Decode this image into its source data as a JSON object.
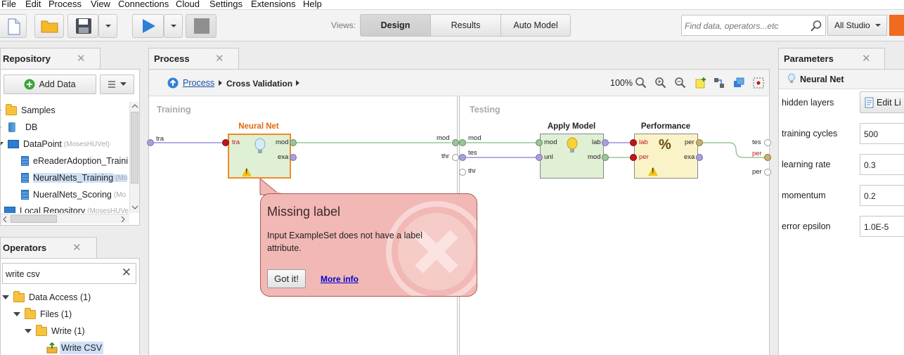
{
  "menu": [
    "File",
    "Edit",
    "Process",
    "View",
    "Connections",
    "Cloud",
    "Settings",
    "Extensions",
    "Help"
  ],
  "toolbar": {
    "views_label": "Views:",
    "views": [
      "Design",
      "Results",
      "Auto Model"
    ],
    "active_view": "Design",
    "search_placeholder": "Find data, operators...etc",
    "studio_label": "All Studio"
  },
  "repository": {
    "tab_title": "Repository",
    "add_data_label": "Add Data",
    "items": [
      {
        "label": "Samples",
        "sub": ""
      },
      {
        "label": "DB",
        "sub": ""
      },
      {
        "label": "DataPoint",
        "sub": "(MosesHUVet)"
      },
      {
        "label": "eReaderAdoption_Traini",
        "sub": ""
      },
      {
        "label": "NeuralNets_Training",
        "sub": "(Mo"
      },
      {
        "label": "NueralNets_Scoring",
        "sub": "(Mo"
      },
      {
        "label": "Local Repository",
        "sub": "(MosesHUVe"
      }
    ]
  },
  "operators": {
    "tab_title": "Operators",
    "search_value": "write csv",
    "tree": [
      {
        "label": "Data Access (1)"
      },
      {
        "label": "Files (1)"
      },
      {
        "label": "Write (1)"
      },
      {
        "label": "Write CSV"
      }
    ]
  },
  "process": {
    "tab_title": "Process",
    "breadcrumb": [
      "Process",
      "Cross Validation"
    ],
    "zoom": "100%",
    "training_label": "Training",
    "testing_label": "Testing",
    "left_port": "tra",
    "neural_net": {
      "title": "Neural Net",
      "in_port": "tra",
      "out_ports": [
        "mod",
        "exa"
      ]
    },
    "divider_ports_left": [
      "mod",
      "thr"
    ],
    "divider_ports_right": [
      "mod",
      "tes",
      "thr"
    ],
    "apply_model": {
      "title": "Apply Model",
      "in_ports": [
        "mod",
        "unl"
      ],
      "out_ports": [
        "lab",
        "mod"
      ]
    },
    "performance": {
      "title": "Performance",
      "in_ports": [
        "lab",
        "per"
      ],
      "out_ports": [
        "per",
        "exa"
      ]
    },
    "right_ports": [
      "tes",
      "per",
      "per"
    ]
  },
  "tooltip": {
    "title": "Missing label",
    "body": "Input ExampleSet does not have a label attribute.",
    "got_it": "Got it!",
    "more_info": "More info"
  },
  "parameters": {
    "tab_title": "Parameters",
    "operator": "Neural Net",
    "rows": [
      {
        "label": "hidden layers",
        "value": "Edit Li"
      },
      {
        "label": "training cycles",
        "value": "500"
      },
      {
        "label": "learning rate",
        "value": "0.3"
      },
      {
        "label": "momentum",
        "value": "0.2"
      },
      {
        "label": "error epsilon",
        "value": "1.0E-5"
      }
    ]
  }
}
